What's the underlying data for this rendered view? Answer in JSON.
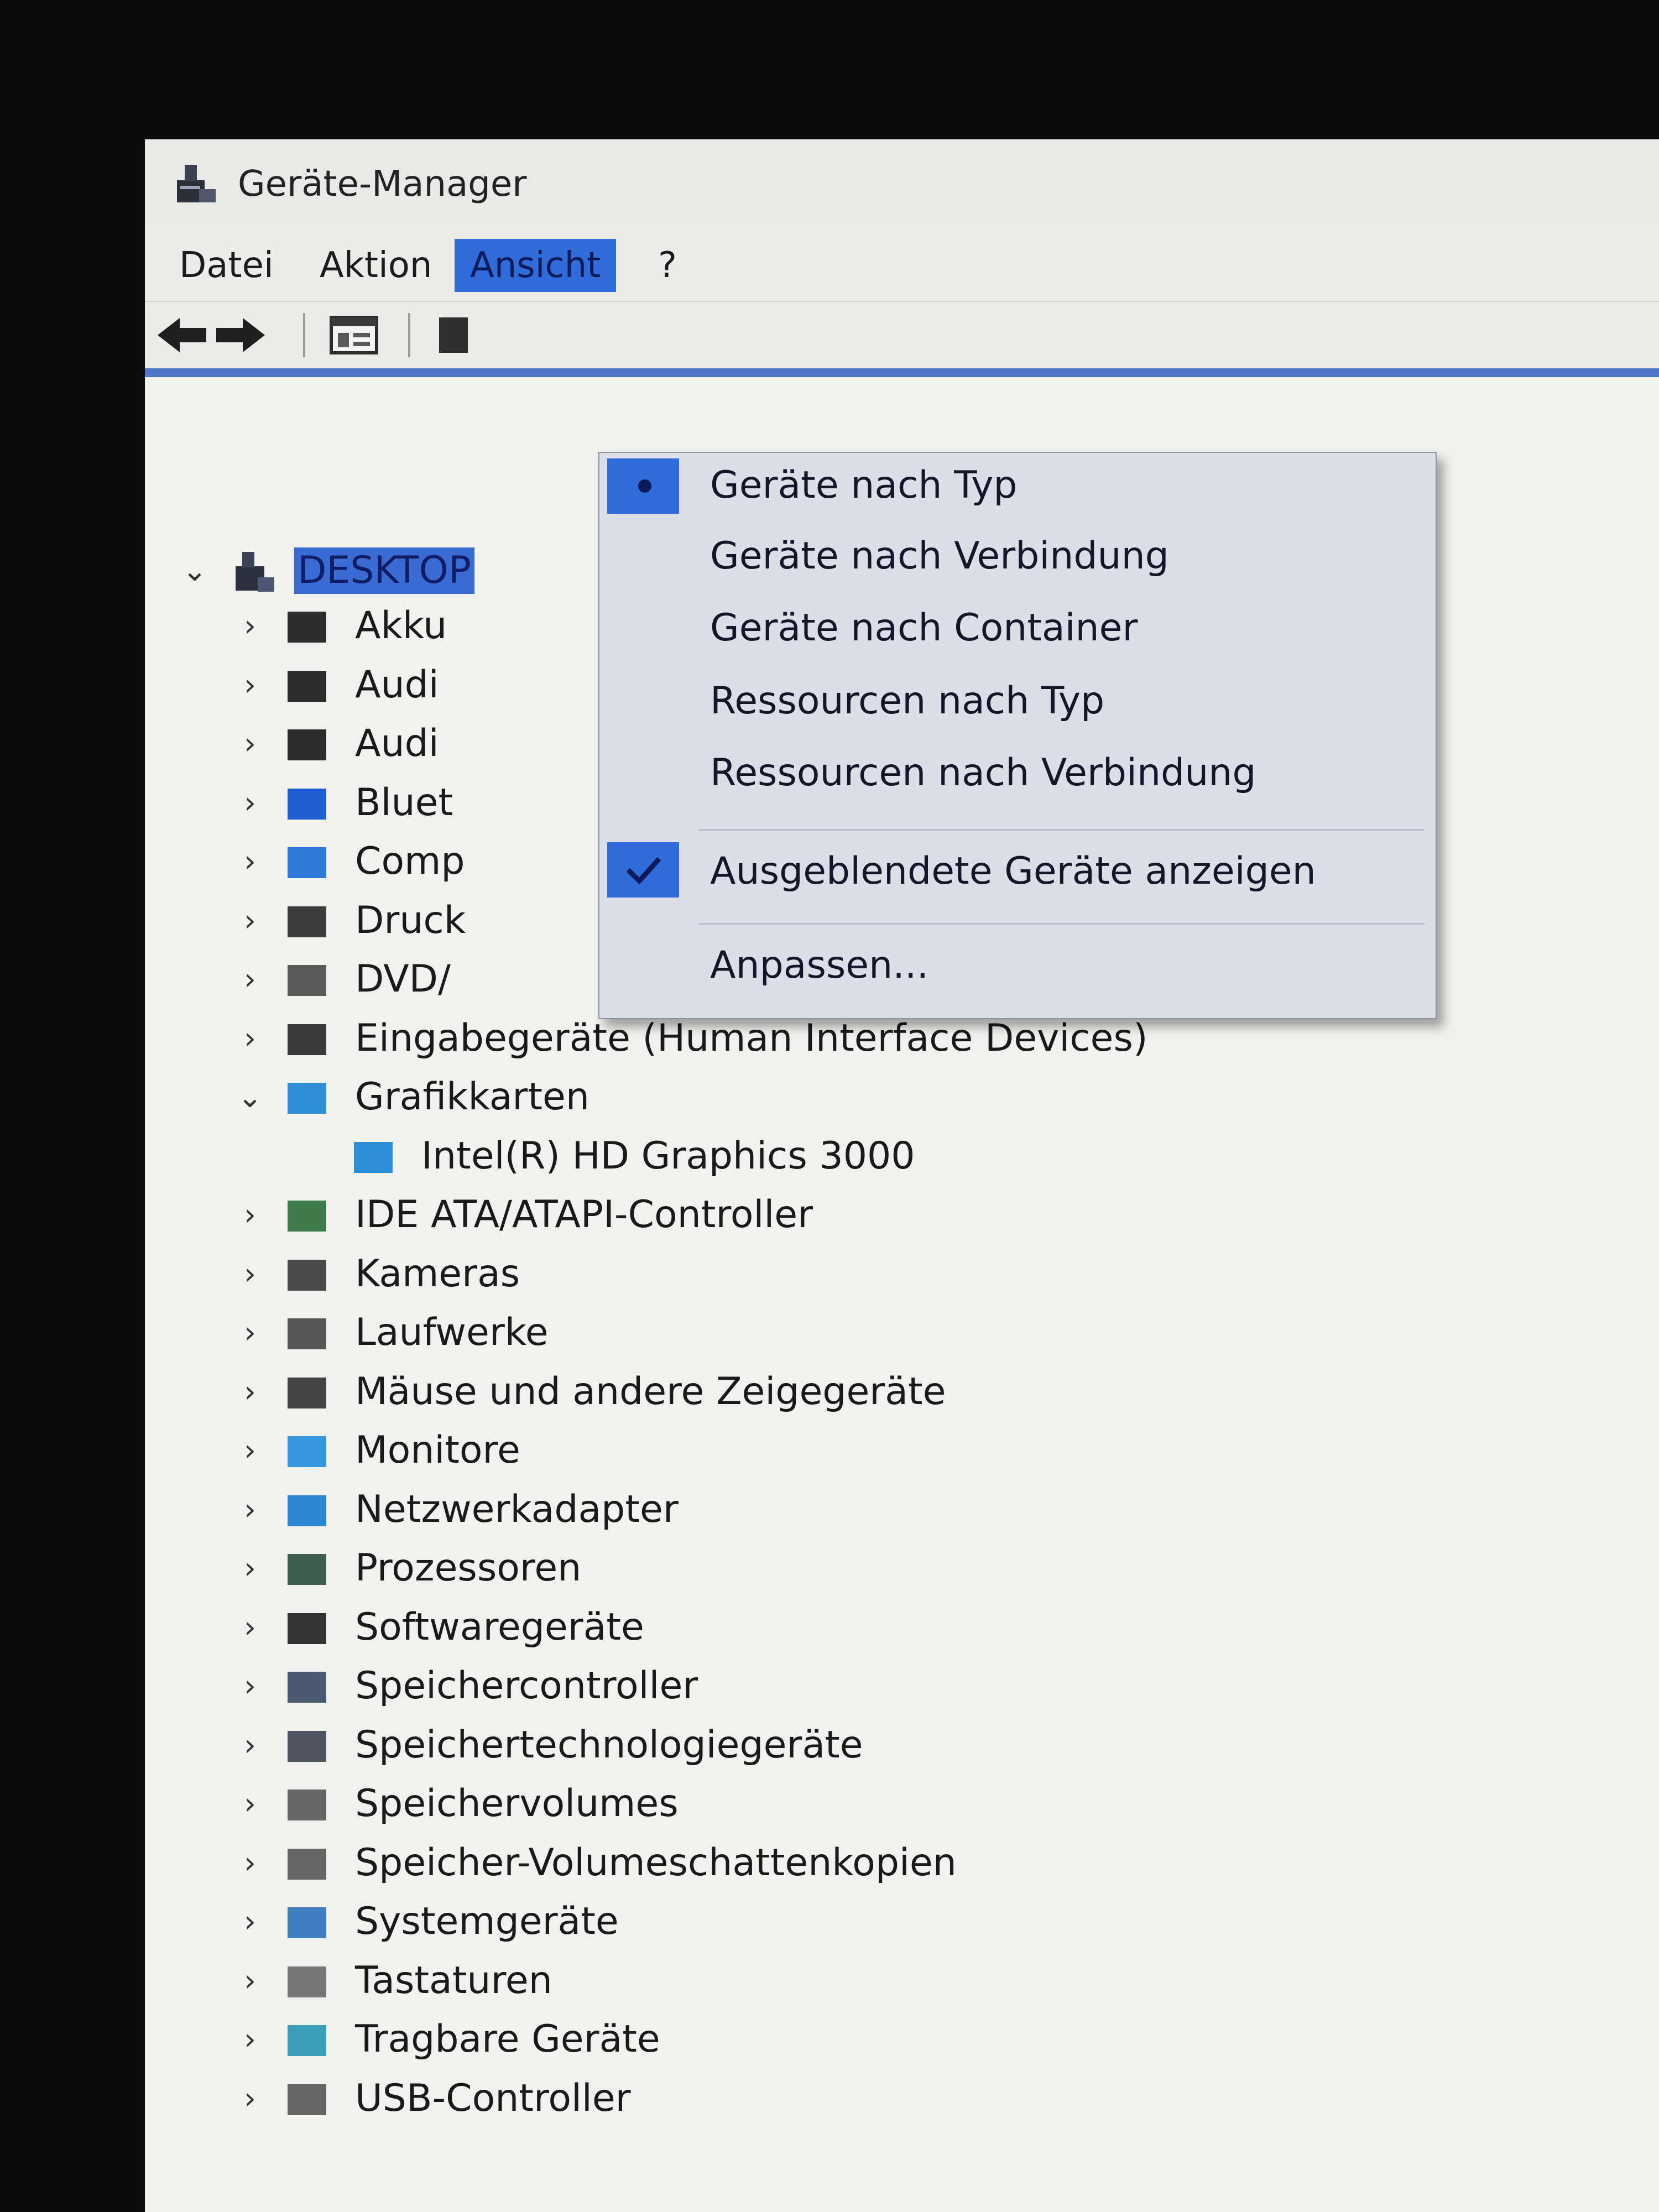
{
  "window": {
    "title": "Geräte-Manager"
  },
  "menubar": {
    "items": [
      {
        "label": "Datei"
      },
      {
        "label": "Aktion"
      },
      {
        "label": "Ansicht",
        "active": true
      },
      {
        "label": "?"
      }
    ]
  },
  "ansicht_menu": {
    "items": [
      {
        "label": "Geräte nach Typ",
        "mark": "radio-dot"
      },
      {
        "label": "Geräte nach Verbindung"
      },
      {
        "label": "Geräte nach Container"
      },
      {
        "label": "Ressourcen nach Typ"
      },
      {
        "label": "Ressourcen nach Verbindung"
      },
      {
        "label": "Ausgeblendete Geräte anzeigen",
        "mark": "check"
      },
      {
        "label": "Anpassen..."
      }
    ]
  },
  "tree": {
    "root": {
      "label": "DESKTOP"
    },
    "categories": [
      {
        "label": "Akku",
        "icon": "battery-icon"
      },
      {
        "label": "Audi",
        "icon": "speaker-icon"
      },
      {
        "label": "Audi",
        "icon": "speaker-icon"
      },
      {
        "label": "Bluet",
        "icon": "bluetooth-icon"
      },
      {
        "label": "Comp",
        "icon": "computer-icon"
      },
      {
        "label": "Druck",
        "icon": "printer-icon"
      },
      {
        "label": "DVD/",
        "icon": "dvd-drive-icon"
      },
      {
        "label": "Eingabegeräte (Human Interface Devices)",
        "icon": "hid-icon"
      },
      {
        "label": "Grafikkarten",
        "icon": "display-adapter-icon",
        "expanded": true,
        "children": [
          {
            "label": "Intel(R) HD Graphics 3000",
            "icon": "display-adapter-icon"
          }
        ]
      },
      {
        "label": "IDE ATA/ATAPI-Controller",
        "icon": "ide-controller-icon"
      },
      {
        "label": "Kameras",
        "icon": "camera-icon"
      },
      {
        "label": "Laufwerke",
        "icon": "disk-drive-icon"
      },
      {
        "label": "Mäuse und andere Zeigegeräte",
        "icon": "mouse-icon"
      },
      {
        "label": "Monitore",
        "icon": "monitor-icon"
      },
      {
        "label": "Netzwerkadapter",
        "icon": "network-adapter-icon"
      },
      {
        "label": "Prozessoren",
        "icon": "processor-icon"
      },
      {
        "label": "Softwaregeräte",
        "icon": "software-device-icon"
      },
      {
        "label": "Speichercontroller",
        "icon": "storage-controller-icon"
      },
      {
        "label": "Speichertechnologiegeräte",
        "icon": "memory-tech-icon"
      },
      {
        "label": "Speichervolumes",
        "icon": "volume-icon"
      },
      {
        "label": "Speicher-Volumeschattenkopien",
        "icon": "shadow-copy-icon"
      },
      {
        "label": "Systemgeräte",
        "icon": "system-device-icon"
      },
      {
        "label": "Tastaturen",
        "icon": "keyboard-icon"
      },
      {
        "label": "Tragbare Geräte",
        "icon": "portable-device-icon"
      },
      {
        "label": "USB-Controller",
        "icon": "usb-icon"
      }
    ]
  },
  "colors": {
    "menu_highlight": "#2f6bd9",
    "dropdown_bg": "#dcdee8",
    "tree_selection": "#3a6bd4"
  }
}
